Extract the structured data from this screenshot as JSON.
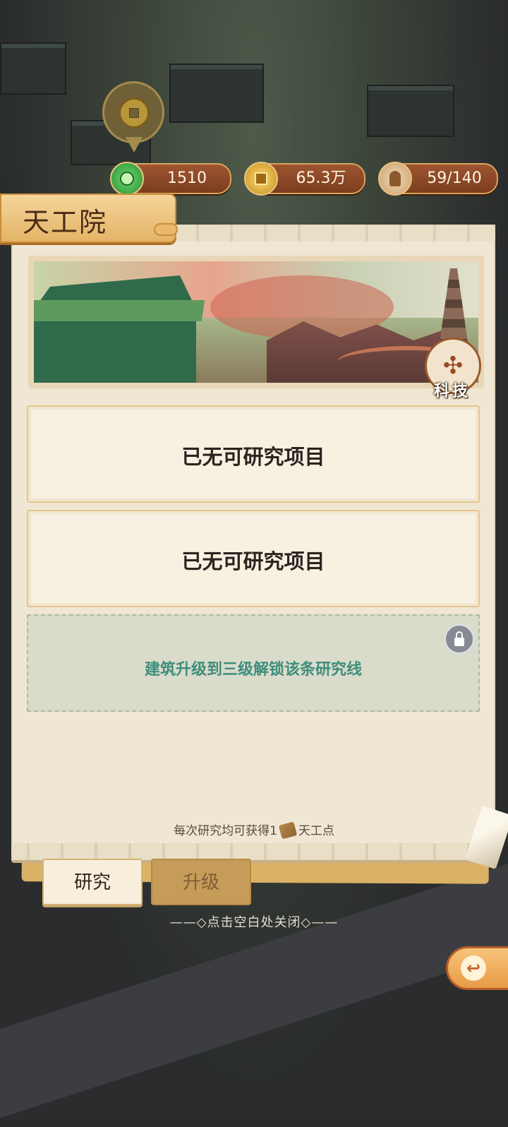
{
  "resources": {
    "jade": "1510",
    "coins": "65.3万",
    "workers": "59/140"
  },
  "panel": {
    "title": "天工院",
    "banner_badge": "科技",
    "slots": [
      "已无可研究项目",
      "已无可研究项目"
    ],
    "locked_slot": "建筑升级到三级解锁该条研究线",
    "footer_prefix": "每次研究均可获得1",
    "footer_suffix": "天工点"
  },
  "tabs": {
    "research": "研究",
    "upgrade": "升级"
  },
  "close_hint": "——◇点击空白处关闭◇——",
  "colors": {
    "accent": "#e3b466",
    "locked_text": "#3f8d7c"
  }
}
